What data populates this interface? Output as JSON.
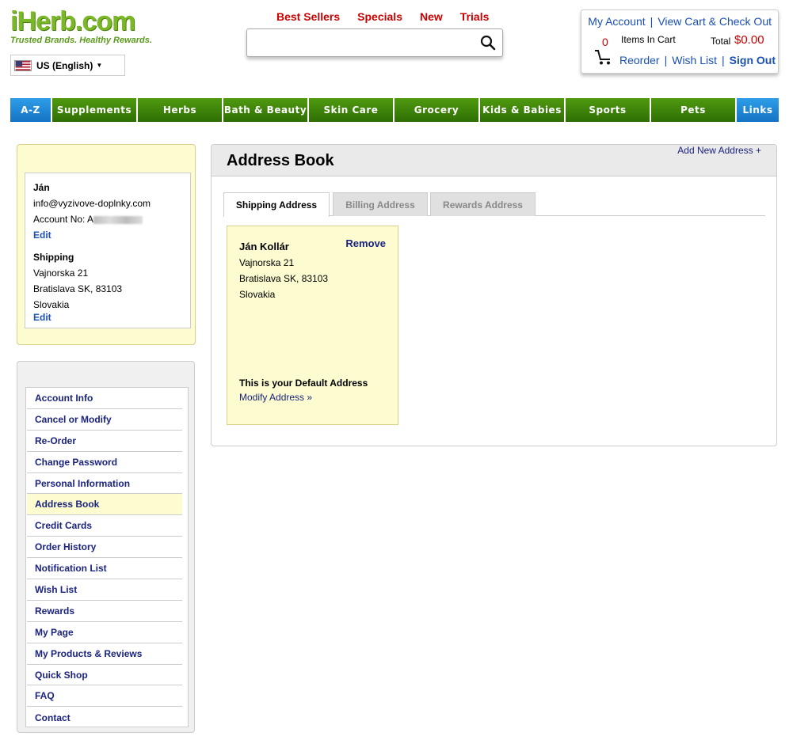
{
  "header": {
    "logo_main": "iHerb.com",
    "logo_tag": "Trusted Brands. Healthy Rewards.",
    "locale": "US (English)",
    "top_links": [
      "Best Sellers",
      "Specials",
      "New",
      "Trials"
    ],
    "search": {
      "placeholder": "",
      "value": ""
    },
    "account": {
      "my_account": "My Account",
      "view_cart": "View Cart & Check Out",
      "cart_count": "0",
      "items_in_cart": "Items In Cart",
      "total_label": "Total",
      "total_value": "$0.00",
      "reorder": "Reorder",
      "wish_list": "Wish List",
      "sign_out": "Sign Out"
    }
  },
  "nav": {
    "items": [
      "A-Z",
      "Supplements",
      "Herbs",
      "Bath & Beauty",
      "Skin Care",
      "Grocery",
      "Kids & Babies",
      "Sports",
      "Pets",
      "Links"
    ]
  },
  "user": {
    "name": "Ján",
    "email": "info@vyzivove-doplnky.com",
    "account_label": "Account No: A",
    "edit1": "Edit",
    "shipping_title": "Shipping",
    "street": "Vajnorska 21",
    "city": "Bratislava SK, 83103",
    "country": "Slovakia",
    "edit2": "Edit"
  },
  "menu": {
    "items": [
      "Account Info",
      "Cancel or Modify",
      "Re-Order",
      "Change Password",
      "Personal Information",
      "Address Book",
      "Credit Cards",
      "Order History",
      "Notification List",
      "Wish List",
      "Rewards",
      "My Page",
      "My Products & Reviews",
      "Quick Shop",
      "FAQ",
      "Contact"
    ],
    "active": "Address Book"
  },
  "main": {
    "title": "Address Book",
    "add_new": "Add New Address +",
    "tabs": [
      "Shipping Address",
      "Billing Address",
      "Rewards Address"
    ],
    "card": {
      "name": "Ján Kollár",
      "remove": "Remove",
      "street": "Vajnorska 21",
      "city": "Bratislava SK, 83103",
      "country": "Slovakia",
      "default_text": "This is your Default Address",
      "modify": "Modify Address »"
    }
  }
}
